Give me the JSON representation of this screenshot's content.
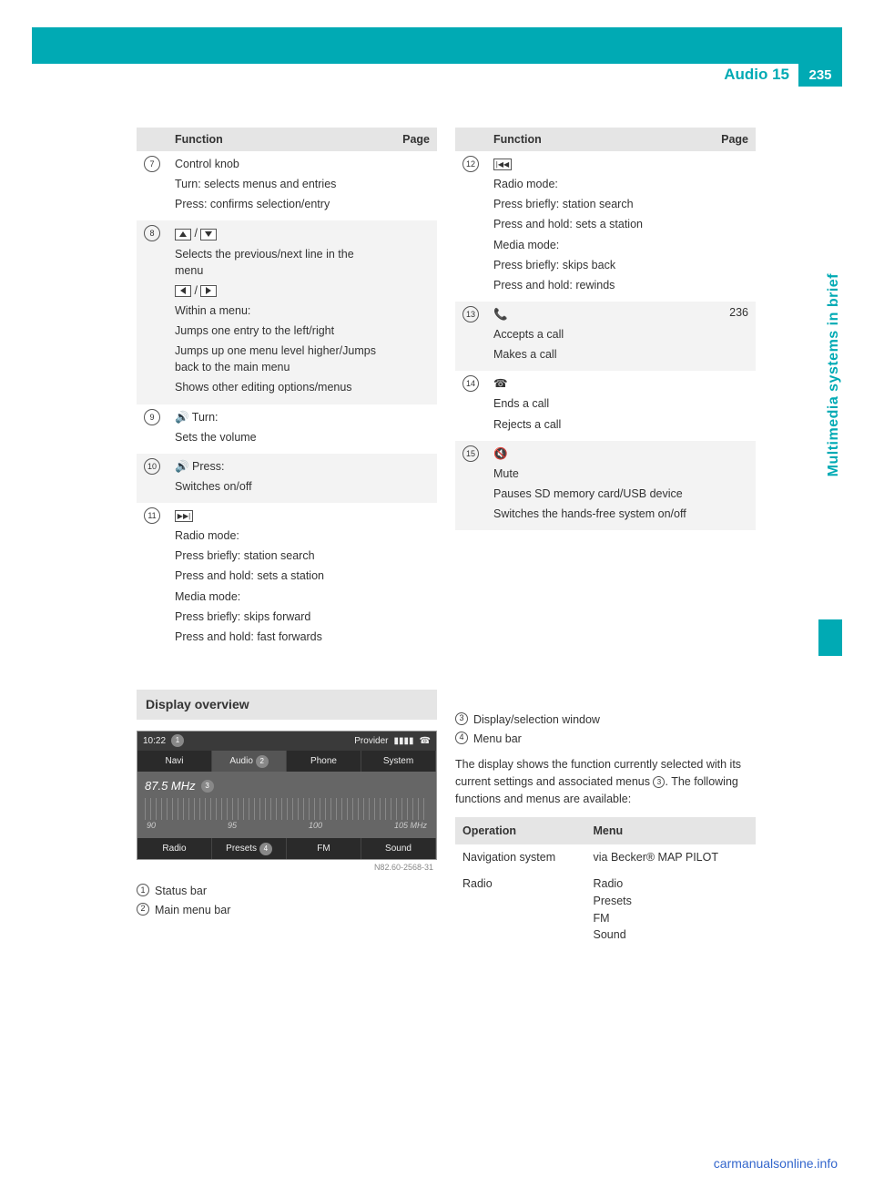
{
  "header": {
    "title": "Audio 15",
    "page_number": "235"
  },
  "side_tab": "Multimedia systems in brief",
  "columns": {
    "left": {
      "head_function": "Function",
      "head_page": "Page",
      "rows": [
        {
          "idx": "7",
          "title": "Control knob",
          "lines": [
            "Turn: selects menus and entries",
            "Press: confirms selection/entry"
          ],
          "page": ""
        },
        {
          "idx": "8",
          "title_html": "arrows-ud",
          "lines": [
            "Selects the previous/next line in the menu"
          ],
          "title2_html": "arrows-lr",
          "lines2": [
            "Within a menu:",
            "Jumps one entry to the left/right",
            "Jumps up one menu level higher/Jumps back to the main menu",
            "Shows other editing options/menus"
          ],
          "page": ""
        },
        {
          "idx": "9",
          "title": "🔊 Turn:",
          "lines": [
            "Sets the volume"
          ],
          "page": ""
        },
        {
          "idx": "10",
          "title": "🔊 Press:",
          "lines": [
            "Switches on/off"
          ],
          "page": ""
        },
        {
          "idx": "11",
          "title_html": "skip-fwd",
          "lines": [
            "Radio mode:",
            "Press briefly: station search",
            "Press and hold: sets a station",
            "Media mode:",
            "Press briefly: skips forward",
            "Press and hold: fast forwards"
          ],
          "page": ""
        }
      ]
    },
    "right": {
      "head_function": "Function",
      "head_page": "Page",
      "rows": [
        {
          "idx": "12",
          "title_html": "skip-back",
          "lines": [
            "Radio mode:",
            "Press briefly: station search",
            "Press and hold: sets a station",
            "Media mode:",
            "Press briefly: skips back",
            "Press and hold: rewinds"
          ],
          "page": ""
        },
        {
          "idx": "13",
          "title_html": "phone-accept",
          "lines": [
            "Accepts a call",
            "Makes a call"
          ],
          "page": "236"
        },
        {
          "idx": "14",
          "title_html": "phone-end",
          "lines": [
            "Ends a call",
            "Rejects a call"
          ],
          "page": ""
        },
        {
          "idx": "15",
          "title_html": "mute",
          "lines": [
            "Mute",
            "Pauses SD memory card/USB device",
            "Switches the hands-free system on/off"
          ],
          "page": ""
        }
      ]
    }
  },
  "display_section": {
    "title": "Display overview",
    "clock": "10:22",
    "provider": "Provider",
    "tabs_top": [
      "Navi",
      "Audio",
      "Phone",
      "System"
    ],
    "freq": "87.5 MHz",
    "ticks": [
      "90",
      "95",
      "100",
      "105 MHz"
    ],
    "tabs_bot": [
      "Radio",
      "Presets",
      "FM",
      "Sound"
    ],
    "caption": "N82.60-2568-31",
    "legend_left": [
      {
        "n": "1",
        "t": "Status bar"
      },
      {
        "n": "2",
        "t": "Main menu bar"
      }
    ],
    "legend_right": [
      {
        "n": "3",
        "t": "Display/selection window"
      },
      {
        "n": "4",
        "t": "Menu bar"
      }
    ],
    "para1": "The display shows the function currently selected with its current settings and associated menus ",
    "para1b": ". The following functions and menus are available:",
    "ops_head1": "Operation",
    "ops_head2": "Menu",
    "ops_rows": [
      {
        "op": "Navigation system",
        "menu": "via Becker® MAP PILOT"
      },
      {
        "op": "Radio",
        "menu": "Radio\nPresets\nFM\nSound"
      }
    ]
  },
  "footer": "carmanualsonline.info"
}
